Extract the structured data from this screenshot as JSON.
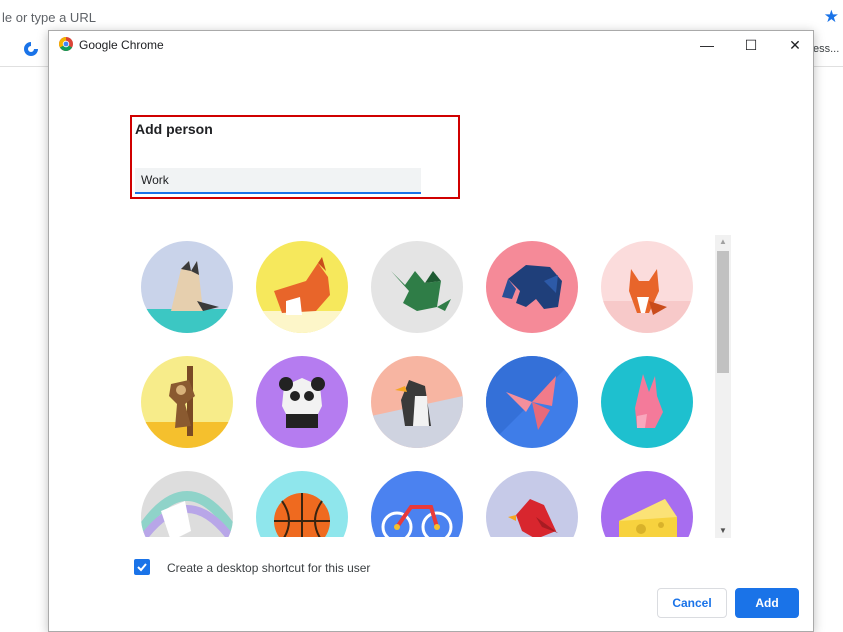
{
  "background": {
    "omnibox_text": "le or type a URL",
    "bookmark_text": "ess...",
    "star_icon": "bookmark-star-icon"
  },
  "window": {
    "title": "Google Chrome",
    "min_glyph": "—",
    "max_glyph": "☐",
    "close_glyph": "✕"
  },
  "form": {
    "heading": "Add person",
    "name_value": "Work"
  },
  "avatars": [
    {
      "name": "avatar-origami-cat",
      "bg": "#c9d3ea"
    },
    {
      "name": "avatar-origami-corgi",
      "bg": "#f6e85c"
    },
    {
      "name": "avatar-origami-dragon",
      "bg": "#e4e4e4"
    },
    {
      "name": "avatar-origami-elephant",
      "bg": "#f58a98"
    },
    {
      "name": "avatar-origami-fox",
      "bg": "#fbdcdc"
    },
    {
      "name": "avatar-origami-monkey",
      "bg": "#f7ec8a"
    },
    {
      "name": "avatar-origami-panda",
      "bg": "#b57cf0"
    },
    {
      "name": "avatar-origami-penguin",
      "bg": "#f7b5a2"
    },
    {
      "name": "avatar-origami-butterfly",
      "bg": "#3f7de8"
    },
    {
      "name": "avatar-origami-rabbit",
      "bg": "#1ec0cf"
    },
    {
      "name": "avatar-origami-unicorn",
      "bg": "#dddddd"
    },
    {
      "name": "avatar-basketball",
      "bg": "#8fe6ec"
    },
    {
      "name": "avatar-bicycle",
      "bg": "#4b82f0"
    },
    {
      "name": "avatar-bird",
      "bg": "#c6cae8"
    },
    {
      "name": "avatar-cheese",
      "bg": "#a76df0"
    }
  ],
  "options": {
    "shortcut_label": "Create a desktop shortcut for this user",
    "shortcut_checked": true
  },
  "buttons": {
    "cancel": "Cancel",
    "add": "Add"
  }
}
